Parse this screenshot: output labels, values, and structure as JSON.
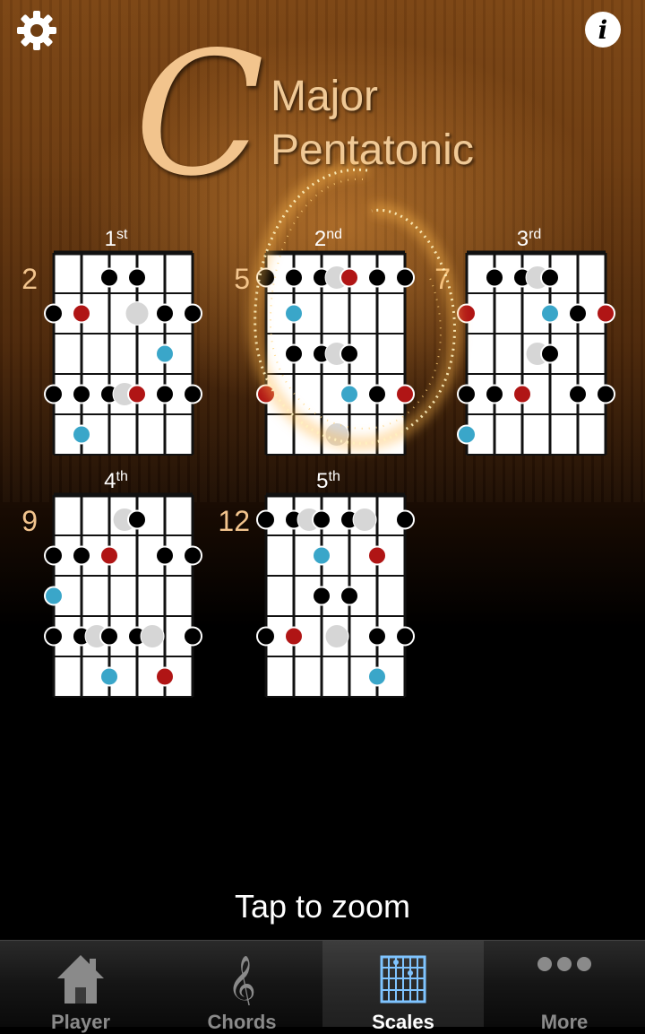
{
  "title": {
    "key": "C",
    "line1": "Major",
    "line2": "Pentatonic"
  },
  "icons": {
    "settings": "gear-icon",
    "info": "info-icon"
  },
  "colors": {
    "root": "#b01515",
    "blue": "#3aa6c9",
    "black": "#000000",
    "ghost": "#d6d6d6"
  },
  "diagrams": [
    {
      "label": "1",
      "suffix": "st",
      "fret": "2",
      "dots": [
        {
          "s": 2,
          "f": 0,
          "c": "k"
        },
        {
          "s": 3,
          "f": 0,
          "c": "k"
        },
        {
          "s": 0,
          "f": 1,
          "c": "k"
        },
        {
          "s": 1,
          "f": 1,
          "c": "r"
        },
        {
          "s": 3,
          "f": 1,
          "c": "g"
        },
        {
          "s": 4,
          "f": 1,
          "c": "k"
        },
        {
          "s": 5,
          "f": 1,
          "c": "k"
        },
        {
          "s": 4,
          "f": 2,
          "c": "b"
        },
        {
          "s": 0,
          "f": 3,
          "c": "k"
        },
        {
          "s": 1,
          "f": 3,
          "c": "k"
        },
        {
          "s": 2,
          "f": 3,
          "c": "k"
        },
        {
          "s": 2.55,
          "f": 3,
          "c": "g"
        },
        {
          "s": 3,
          "f": 3,
          "c": "r"
        },
        {
          "s": 4,
          "f": 3,
          "c": "k"
        },
        {
          "s": 5,
          "f": 3,
          "c": "k"
        },
        {
          "s": 1,
          "f": 4,
          "c": "b"
        }
      ]
    },
    {
      "label": "2",
      "suffix": "nd",
      "fret": "5",
      "dots": [
        {
          "s": 0,
          "f": 0,
          "c": "k"
        },
        {
          "s": 1,
          "f": 0,
          "c": "k"
        },
        {
          "s": 2,
          "f": 0,
          "c": "k"
        },
        {
          "s": 2.55,
          "f": 0,
          "c": "g"
        },
        {
          "s": 3,
          "f": 0,
          "c": "r"
        },
        {
          "s": 4,
          "f": 0,
          "c": "k"
        },
        {
          "s": 5,
          "f": 0,
          "c": "k"
        },
        {
          "s": 1,
          "f": 1,
          "c": "b"
        },
        {
          "s": 1,
          "f": 2,
          "c": "k"
        },
        {
          "s": 2,
          "f": 2,
          "c": "k"
        },
        {
          "s": 2.55,
          "f": 2,
          "c": "g"
        },
        {
          "s": 3,
          "f": 2,
          "c": "k"
        },
        {
          "s": 0,
          "f": 3,
          "c": "r"
        },
        {
          "s": 3,
          "f": 3,
          "c": "b"
        },
        {
          "s": 4,
          "f": 3,
          "c": "k"
        },
        {
          "s": 5,
          "f": 3,
          "c": "r"
        },
        {
          "s": 2.55,
          "f": 4,
          "c": "g"
        }
      ]
    },
    {
      "label": "3",
      "suffix": "rd",
      "fret": "7",
      "dots": [
        {
          "s": 1,
          "f": 0,
          "c": "k"
        },
        {
          "s": 2,
          "f": 0,
          "c": "k"
        },
        {
          "s": 2.55,
          "f": 0,
          "c": "g"
        },
        {
          "s": 3,
          "f": 0,
          "c": "k"
        },
        {
          "s": 0,
          "f": 1,
          "c": "r"
        },
        {
          "s": 3,
          "f": 1,
          "c": "b"
        },
        {
          "s": 4,
          "f": 1,
          "c": "k"
        },
        {
          "s": 5,
          "f": 1,
          "c": "r"
        },
        {
          "s": 2.55,
          "f": 2,
          "c": "g"
        },
        {
          "s": 3,
          "f": 2,
          "c": "k"
        },
        {
          "s": 0,
          "f": 3,
          "c": "k"
        },
        {
          "s": 1,
          "f": 3,
          "c": "k"
        },
        {
          "s": 2,
          "f": 3,
          "c": "r"
        },
        {
          "s": 4,
          "f": 3,
          "c": "k"
        },
        {
          "s": 5,
          "f": 3,
          "c": "k"
        },
        {
          "s": 0,
          "f": 4,
          "c": "b"
        }
      ]
    },
    {
      "label": "4",
      "suffix": "th",
      "fret": "9",
      "dots": [
        {
          "s": 2.55,
          "f": 0,
          "c": "g"
        },
        {
          "s": 3,
          "f": 0,
          "c": "k"
        },
        {
          "s": 0,
          "f": 1,
          "c": "k"
        },
        {
          "s": 1,
          "f": 1,
          "c": "k"
        },
        {
          "s": 2,
          "f": 1,
          "c": "r"
        },
        {
          "s": 4,
          "f": 1,
          "c": "k"
        },
        {
          "s": 5,
          "f": 1,
          "c": "k"
        },
        {
          "s": 0,
          "f": 2,
          "c": "b"
        },
        {
          "s": 0,
          "f": 3,
          "c": "k"
        },
        {
          "s": 1,
          "f": 3,
          "c": "k"
        },
        {
          "s": 1.55,
          "f": 3,
          "c": "g"
        },
        {
          "s": 2,
          "f": 3,
          "c": "k"
        },
        {
          "s": 3,
          "f": 3,
          "c": "k"
        },
        {
          "s": 3.55,
          "f": 3,
          "c": "g"
        },
        {
          "s": 5,
          "f": 3,
          "c": "k"
        },
        {
          "s": 2,
          "f": 4,
          "c": "b"
        },
        {
          "s": 4,
          "f": 4,
          "c": "r"
        }
      ]
    },
    {
      "label": "5",
      "suffix": "th",
      "fret": "12",
      "dots": [
        {
          "s": 0,
          "f": 0,
          "c": "k"
        },
        {
          "s": 1,
          "f": 0,
          "c": "k"
        },
        {
          "s": 1.55,
          "f": 0,
          "c": "g"
        },
        {
          "s": 2,
          "f": 0,
          "c": "k"
        },
        {
          "s": 3,
          "f": 0,
          "c": "k"
        },
        {
          "s": 3.55,
          "f": 0,
          "c": "g"
        },
        {
          "s": 5,
          "f": 0,
          "c": "k"
        },
        {
          "s": 2,
          "f": 1,
          "c": "b"
        },
        {
          "s": 4,
          "f": 1,
          "c": "r"
        },
        {
          "s": 2,
          "f": 2,
          "c": "k"
        },
        {
          "s": 3,
          "f": 2,
          "c": "k"
        },
        {
          "s": 0,
          "f": 3,
          "c": "k"
        },
        {
          "s": 1,
          "f": 3,
          "c": "r"
        },
        {
          "s": 2.55,
          "f": 3,
          "c": "g"
        },
        {
          "s": 4,
          "f": 3,
          "c": "k"
        },
        {
          "s": 5,
          "f": 3,
          "c": "k"
        },
        {
          "s": 4,
          "f": 4,
          "c": "b"
        }
      ]
    }
  ],
  "hint": "Tap to zoom",
  "tabs": [
    {
      "label": "Player",
      "icon": "house-icon"
    },
    {
      "label": "Chords",
      "icon": "treble-clef-icon"
    },
    {
      "label": "Scales",
      "icon": "fretboard-icon"
    },
    {
      "label": "More",
      "icon": "more-icon"
    }
  ]
}
